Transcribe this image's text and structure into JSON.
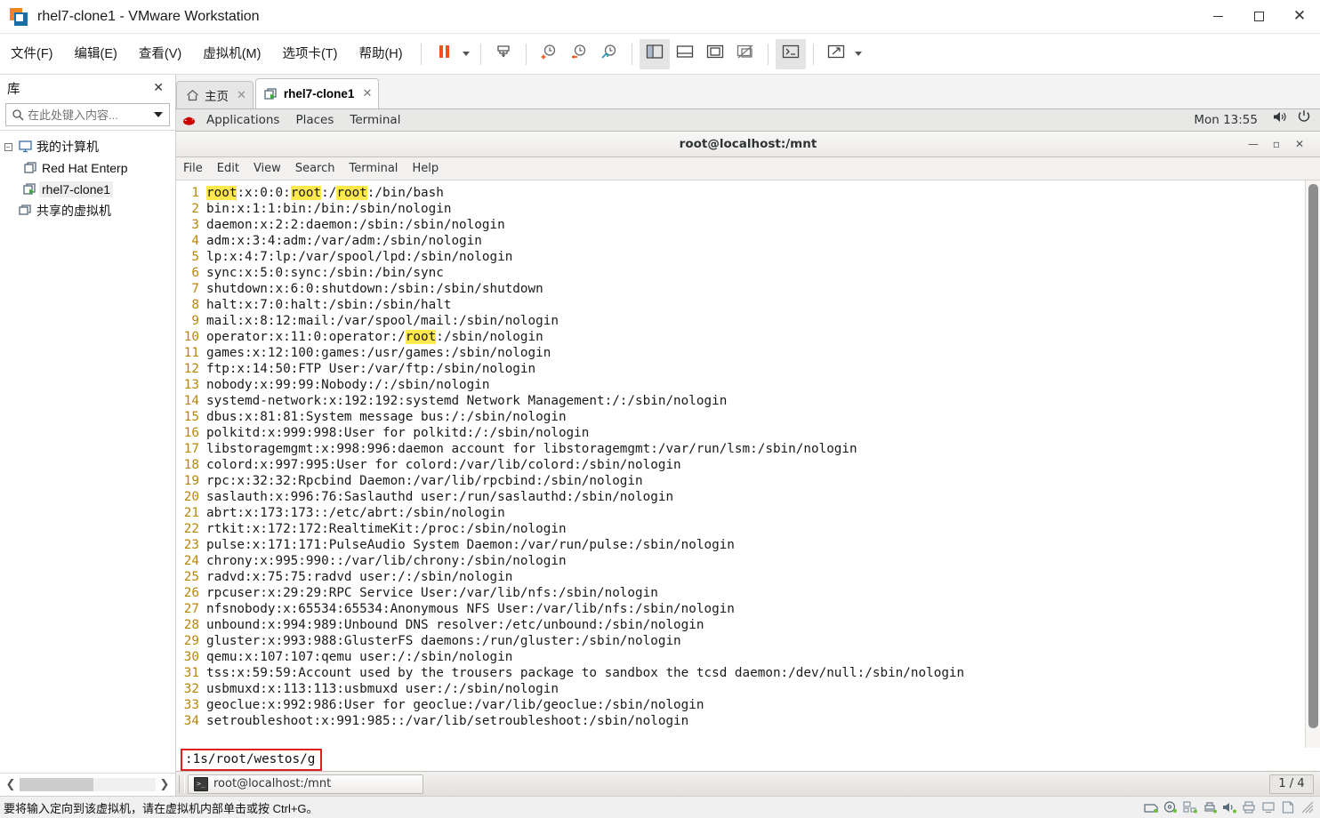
{
  "window": {
    "title": "rhel7-clone1 - VMware Workstation",
    "logo_icon": "vmware-logo-icon",
    "minimize_label": "Minimize",
    "maximize_label": "Maximize",
    "close_label": "Close"
  },
  "menubar": {
    "items": [
      {
        "label": "文件(F)",
        "name": "menu-file"
      },
      {
        "label": "编辑(E)",
        "name": "menu-edit"
      },
      {
        "label": "查看(V)",
        "name": "menu-view"
      },
      {
        "label": "虚拟机(M)",
        "name": "menu-vm"
      },
      {
        "label": "选项卡(T)",
        "name": "menu-tabs"
      },
      {
        "label": "帮助(H)",
        "name": "menu-help"
      }
    ],
    "toolbar": [
      {
        "name": "power-pause-button",
        "icon": "pause-icon"
      },
      {
        "name": "power-dropdown-button",
        "icon": "chevron-down-icon"
      },
      {
        "name": "send-ctrl-alt-del-button",
        "icon": "send-keys-icon"
      },
      {
        "name": "take-snapshot-button",
        "icon": "snapshot-add-icon"
      },
      {
        "name": "revert-snapshot-button",
        "icon": "snapshot-revert-icon"
      },
      {
        "name": "snapshot-manager-button",
        "icon": "snapshot-manager-icon"
      },
      {
        "name": "show-library-button",
        "icon": "library-panel-icon"
      },
      {
        "name": "show-thumbnail-bar-button",
        "icon": "thumbnail-bar-icon"
      },
      {
        "name": "full-screen-button",
        "icon": "fullscreen-icon"
      },
      {
        "name": "unity-mode-button",
        "icon": "unity-mode-icon"
      },
      {
        "name": "console-view-button",
        "icon": "terminal-console-icon"
      },
      {
        "name": "stretch-guest-button",
        "icon": "stretch-icon"
      },
      {
        "name": "stretch-dropdown-button",
        "icon": "chevron-down-icon"
      }
    ]
  },
  "sidebar": {
    "title": "库",
    "close_label": "✕",
    "search_placeholder": "在此处键入内容...",
    "search_value": "",
    "tree": [
      {
        "label": "我的计算机",
        "icon": "computer-icon",
        "indent": 0,
        "expander": "−",
        "selected": false
      },
      {
        "label": "Red Hat Enterp",
        "icon": "vm-icon",
        "indent": 1,
        "expander": "",
        "selected": false
      },
      {
        "label": "rhel7-clone1",
        "icon": "vm-running-icon",
        "indent": 1,
        "expander": "",
        "selected": true
      },
      {
        "label": "共享的虚拟机",
        "icon": "shared-vms-icon",
        "indent": 0,
        "expander": "",
        "selected": false
      }
    ]
  },
  "tabs": [
    {
      "label": "主页",
      "icon": "home-icon",
      "active": false,
      "close": "✕",
      "name": "tab-home"
    },
    {
      "label": "rhel7-clone1",
      "icon": "vm-running-icon",
      "active": true,
      "close": "✕",
      "name": "tab-rhel7-clone1"
    }
  ],
  "gnome_panel": {
    "logo_icon": "redhat-logo-icon",
    "menus": [
      {
        "label": "Applications",
        "name": "gnome-menu-applications"
      },
      {
        "label": "Places",
        "name": "gnome-menu-places"
      },
      {
        "label": "Terminal",
        "name": "gnome-menu-terminal"
      }
    ],
    "clock": "Mon 13:55",
    "volume_icon": "volume-icon",
    "power_icon": "power-icon"
  },
  "terminal": {
    "title": "root@localhost:/mnt",
    "minimize": "—",
    "maximize": "▫",
    "close": "✕",
    "menu": [
      {
        "label": "File",
        "name": "terminal-menu-file"
      },
      {
        "label": "Edit",
        "name": "terminal-menu-edit"
      },
      {
        "label": "View",
        "name": "terminal-menu-view"
      },
      {
        "label": "Search",
        "name": "terminal-menu-search"
      },
      {
        "label": "Terminal",
        "name": "terminal-menu-terminal"
      },
      {
        "label": "Help",
        "name": "terminal-menu-help"
      }
    ],
    "highlight_color": "#ffe94d",
    "linenum_color": "#b8860b",
    "lines": [
      {
        "n": "1",
        "segments": [
          {
            "t": "root",
            "hl": true
          },
          {
            "t": ":x:0:0:"
          },
          {
            "t": "root",
            "hl": true
          },
          {
            "t": ":/"
          },
          {
            "t": "root",
            "hl": true
          },
          {
            "t": ":/bin/bash"
          }
        ]
      },
      {
        "n": "2",
        "segments": [
          {
            "t": "bin:x:1:1:bin:/bin:/sbin/nologin"
          }
        ]
      },
      {
        "n": "3",
        "segments": [
          {
            "t": "daemon:x:2:2:daemon:/sbin:/sbin/nologin"
          }
        ]
      },
      {
        "n": "4",
        "segments": [
          {
            "t": "adm:x:3:4:adm:/var/adm:/sbin/nologin"
          }
        ]
      },
      {
        "n": "5",
        "segments": [
          {
            "t": "lp:x:4:7:lp:/var/spool/lpd:/sbin/nologin"
          }
        ]
      },
      {
        "n": "6",
        "segments": [
          {
            "t": "sync:x:5:0:sync:/sbin:/bin/sync"
          }
        ]
      },
      {
        "n": "7",
        "segments": [
          {
            "t": "shutdown:x:6:0:shutdown:/sbin:/sbin/shutdown"
          }
        ]
      },
      {
        "n": "8",
        "segments": [
          {
            "t": "halt:x:7:0:halt:/sbin:/sbin/halt"
          }
        ]
      },
      {
        "n": "9",
        "segments": [
          {
            "t": "mail:x:8:12:mail:/var/spool/mail:/sbin/nologin"
          }
        ]
      },
      {
        "n": "10",
        "segments": [
          {
            "t": "operator:x:11:0:operator:/"
          },
          {
            "t": "root",
            "hl": true
          },
          {
            "t": ":/sbin/nologin"
          }
        ]
      },
      {
        "n": "11",
        "segments": [
          {
            "t": "games:x:12:100:games:/usr/games:/sbin/nologin"
          }
        ]
      },
      {
        "n": "12",
        "segments": [
          {
            "t": "ftp:x:14:50:FTP User:/var/ftp:/sbin/nologin"
          }
        ]
      },
      {
        "n": "13",
        "segments": [
          {
            "t": "nobody:x:99:99:Nobody:/:/sbin/nologin"
          }
        ]
      },
      {
        "n": "14",
        "segments": [
          {
            "t": "systemd-network:x:192:192:systemd Network Management:/:/sbin/nologin"
          }
        ]
      },
      {
        "n": "15",
        "segments": [
          {
            "t": "dbus:x:81:81:System message bus:/:/sbin/nologin"
          }
        ]
      },
      {
        "n": "16",
        "segments": [
          {
            "t": "polkitd:x:999:998:User for polkitd:/:/sbin/nologin"
          }
        ]
      },
      {
        "n": "17",
        "segments": [
          {
            "t": "libstoragemgmt:x:998:996:daemon account for libstoragemgmt:/var/run/lsm:/sbin/nologin"
          }
        ]
      },
      {
        "n": "18",
        "segments": [
          {
            "t": "colord:x:997:995:User for colord:/var/lib/colord:/sbin/nologin"
          }
        ]
      },
      {
        "n": "19",
        "segments": [
          {
            "t": "rpc:x:32:32:Rpcbind Daemon:/var/lib/rpcbind:/sbin/nologin"
          }
        ]
      },
      {
        "n": "20",
        "segments": [
          {
            "t": "saslauth:x:996:76:Saslauthd user:/run/saslauthd:/sbin/nologin"
          }
        ]
      },
      {
        "n": "21",
        "segments": [
          {
            "t": "abrt:x:173:173::/etc/abrt:/sbin/nologin"
          }
        ]
      },
      {
        "n": "22",
        "segments": [
          {
            "t": "rtkit:x:172:172:RealtimeKit:/proc:/sbin/nologin"
          }
        ]
      },
      {
        "n": "23",
        "segments": [
          {
            "t": "pulse:x:171:171:PulseAudio System Daemon:/var/run/pulse:/sbin/nologin"
          }
        ]
      },
      {
        "n": "24",
        "segments": [
          {
            "t": "chrony:x:995:990::/var/lib/chrony:/sbin/nologin"
          }
        ]
      },
      {
        "n": "25",
        "segments": [
          {
            "t": "radvd:x:75:75:radvd user:/:/sbin/nologin"
          }
        ]
      },
      {
        "n": "26",
        "segments": [
          {
            "t": "rpcuser:x:29:29:RPC Service User:/var/lib/nfs:/sbin/nologin"
          }
        ]
      },
      {
        "n": "27",
        "segments": [
          {
            "t": "nfsnobody:x:65534:65534:Anonymous NFS User:/var/lib/nfs:/sbin/nologin"
          }
        ]
      },
      {
        "n": "28",
        "segments": [
          {
            "t": "unbound:x:994:989:Unbound DNS resolver:/etc/unbound:/sbin/nologin"
          }
        ]
      },
      {
        "n": "29",
        "segments": [
          {
            "t": "gluster:x:993:988:GlusterFS daemons:/run/gluster:/sbin/nologin"
          }
        ]
      },
      {
        "n": "30",
        "segments": [
          {
            "t": "qemu:x:107:107:qemu user:/:/sbin/nologin"
          }
        ]
      },
      {
        "n": "31",
        "segments": [
          {
            "t": "tss:x:59:59:Account used by the trousers package to sandbox the tcsd daemon:/dev/null:/sbin/nologin"
          }
        ]
      },
      {
        "n": "32",
        "segments": [
          {
            "t": "usbmuxd:x:113:113:usbmuxd user:/:/sbin/nologin"
          }
        ]
      },
      {
        "n": "33",
        "segments": [
          {
            "t": "geoclue:x:992:986:User for geoclue:/var/lib/geoclue:/sbin/nologin"
          }
        ]
      },
      {
        "n": "34",
        "segments": [
          {
            "t": "setroubleshoot:x:991:985::/var/lib/setroubleshoot:/sbin/nologin"
          }
        ]
      }
    ],
    "command": ":1s/root/westos/g",
    "annotation_color": "#e02020"
  },
  "gnome_taskbar": {
    "window_button": "root@localhost:/mnt",
    "window_icon": "terminal-icon",
    "workspace": "1 / 4"
  },
  "statusbar": {
    "message": "要将输入定向到该虚拟机，请在虚拟机内部单击或按 Ctrl+G。",
    "devices": [
      {
        "name": "status-hard-disk-icon",
        "icon": "hard-disk-icon"
      },
      {
        "name": "status-cd-dvd-icon",
        "icon": "cd-dvd-icon"
      },
      {
        "name": "status-network-icon",
        "icon": "network-adapter-icon"
      },
      {
        "name": "status-usb-icon",
        "icon": "usb-printer-icon"
      },
      {
        "name": "status-sound-icon",
        "icon": "sound-card-icon"
      },
      {
        "name": "status-printer-icon",
        "icon": "printer-icon"
      },
      {
        "name": "status-display-icon",
        "icon": "display-icon"
      },
      {
        "name": "status-floppy-icon",
        "icon": "floppy-icon"
      }
    ]
  }
}
